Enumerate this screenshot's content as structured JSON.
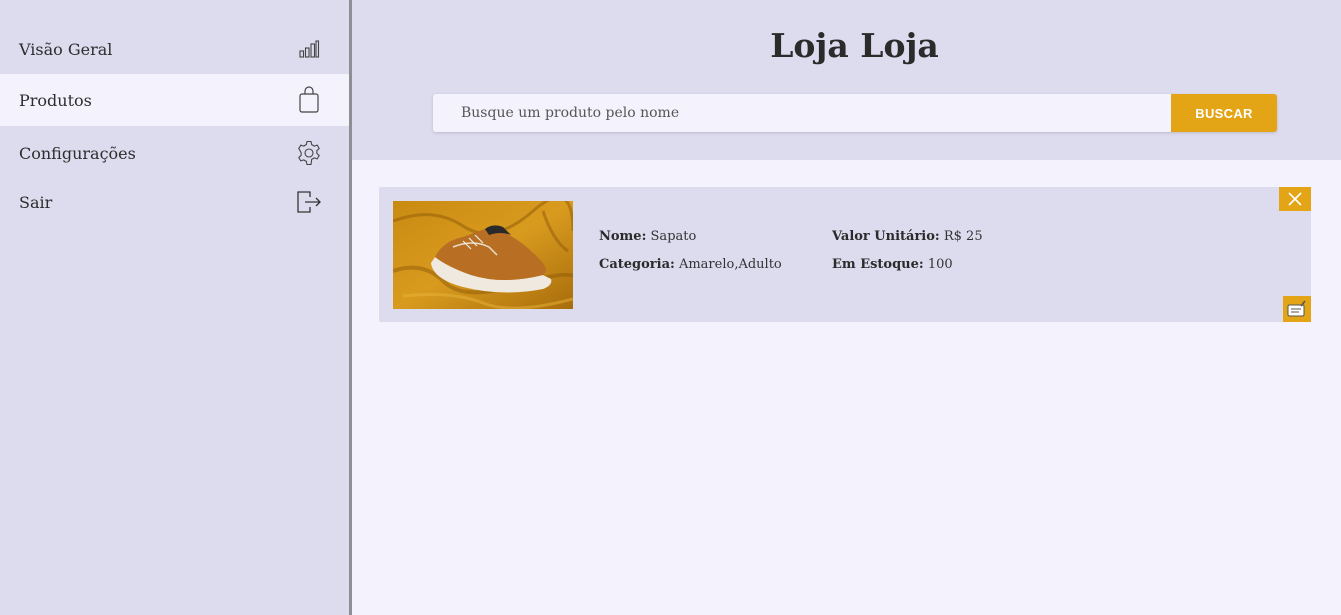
{
  "sidebar": {
    "items": [
      {
        "label": "Visão Geral",
        "icon": "bar-chart-icon",
        "active": false
      },
      {
        "label": "Produtos",
        "icon": "shopping-bag-icon",
        "active": true
      },
      {
        "label": "Configurações",
        "icon": "gear-icon",
        "active": false
      },
      {
        "label": "Sair",
        "icon": "logout-icon",
        "active": false
      }
    ]
  },
  "header": {
    "title": "Loja Loja",
    "search": {
      "placeholder": "Busque um produto pelo nome",
      "value": "",
      "button_label": "BUSCAR"
    }
  },
  "products": [
    {
      "name_label": "Nome:",
      "name": "Sapato",
      "category_label": "Categoria:",
      "category": "Amarelo,Adulto",
      "price_label": "Valor Unitário:",
      "price": "R$ 25",
      "stock_label": "Em Estoque:",
      "stock": "100",
      "image_icon": "sneaker-photo"
    }
  ],
  "colors": {
    "accent": "#e3a516",
    "sidebar_bg": "#dddbee",
    "content_bg": "#f4f3fd",
    "card_bg": "#dddbee",
    "divider": "#8e8e96"
  }
}
